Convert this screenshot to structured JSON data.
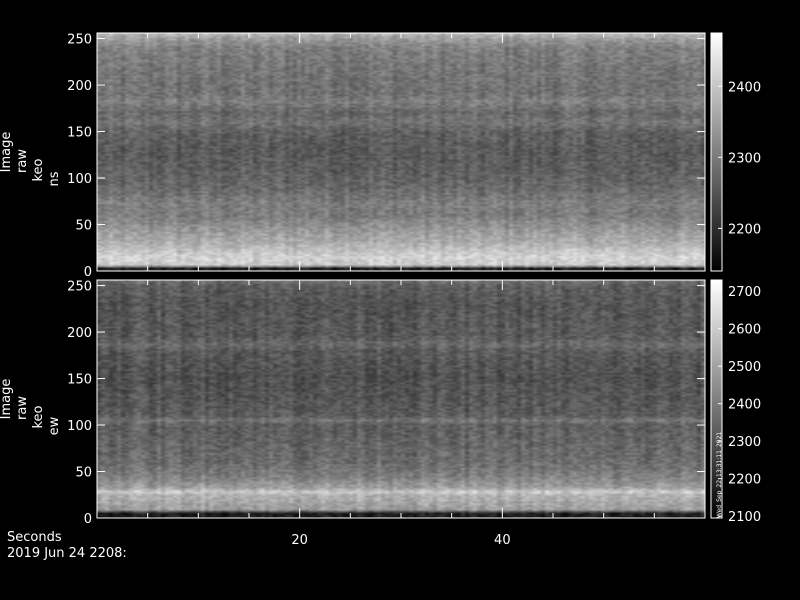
{
  "chart_data": [
    {
      "type": "heatmap",
      "panel": "ns",
      "ylabel_lines": [
        "Image",
        "raw",
        "keo",
        "ns"
      ],
      "x_range": [
        0,
        60
      ],
      "y_range": [
        0,
        256
      ],
      "y_ticks": [
        0,
        50,
        100,
        150,
        200,
        250
      ],
      "x_ticks": [
        20,
        40
      ],
      "colorbar": {
        "range": [
          2140,
          2475
        ],
        "ticks": [
          2200,
          2300,
          2400
        ]
      },
      "brightness_profile": [
        [
          0,
          0.08
        ],
        [
          3,
          0.1
        ],
        [
          6,
          0.82
        ],
        [
          15,
          0.85
        ],
        [
          30,
          0.7
        ],
        [
          45,
          0.6
        ],
        [
          60,
          0.48
        ],
        [
          72,
          0.5
        ],
        [
          90,
          0.4
        ],
        [
          110,
          0.36
        ],
        [
          130,
          0.34
        ],
        [
          150,
          0.37
        ],
        [
          160,
          0.45
        ],
        [
          170,
          0.4
        ],
        [
          183,
          0.5
        ],
        [
          190,
          0.44
        ],
        [
          220,
          0.46
        ],
        [
          240,
          0.5
        ],
        [
          250,
          0.62
        ],
        [
          256,
          0.75
        ]
      ]
    },
    {
      "type": "heatmap",
      "panel": "ew",
      "ylabel_lines": [
        "Image",
        "raw",
        "keo",
        "ew"
      ],
      "x_range": [
        0,
        60
      ],
      "y_range": [
        0,
        256
      ],
      "y_ticks": [
        0,
        50,
        100,
        150,
        200,
        250
      ],
      "x_ticks": [
        20,
        40
      ],
      "colorbar": {
        "range": [
          2095,
          2730
        ],
        "ticks": [
          2100,
          2200,
          2300,
          2400,
          2500,
          2600,
          2700
        ],
        "annotation": "Wed_Sep_22_13:31:11_2021"
      },
      "brightness_profile": [
        [
          0,
          0.05
        ],
        [
          6,
          0.1
        ],
        [
          8,
          0.62
        ],
        [
          15,
          0.66
        ],
        [
          25,
          0.72
        ],
        [
          28,
          0.85
        ],
        [
          32,
          0.64
        ],
        [
          45,
          0.5
        ],
        [
          60,
          0.42
        ],
        [
          100,
          0.36
        ],
        [
          105,
          0.46
        ],
        [
          110,
          0.35
        ],
        [
          150,
          0.3
        ],
        [
          180,
          0.34
        ],
        [
          186,
          0.42
        ],
        [
          195,
          0.34
        ],
        [
          230,
          0.32
        ],
        [
          250,
          0.36
        ],
        [
          256,
          0.45
        ]
      ]
    }
  ],
  "footer": {
    "xlabel": "Seconds",
    "date": "2019 Jun 24 2208:"
  }
}
